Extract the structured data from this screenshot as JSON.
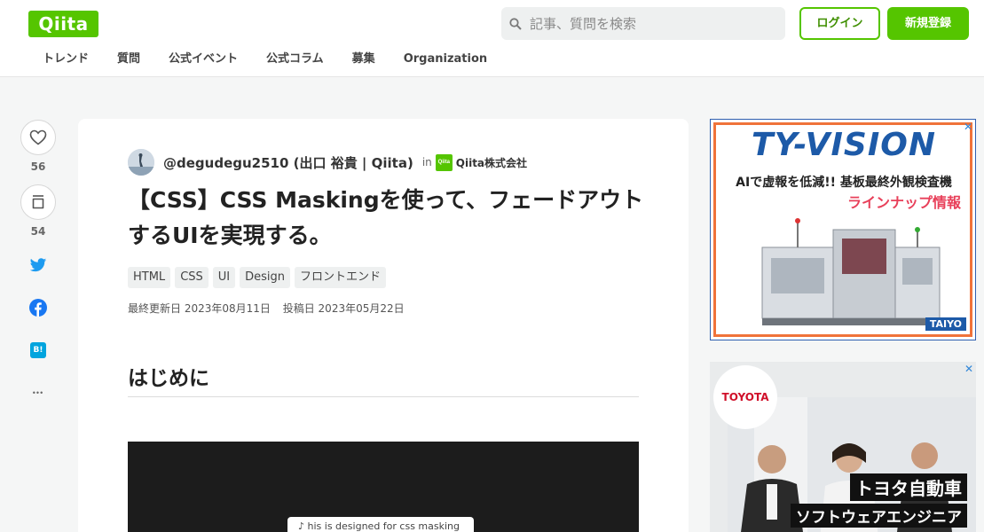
{
  "header": {
    "logo_text": "Qiita",
    "search_placeholder": "記事、質問を検索",
    "login_label": "ログイン",
    "signup_label": "新規登録",
    "nav": [
      "トレンド",
      "質問",
      "公式イベント",
      "公式コラム",
      "募集",
      "Organization"
    ]
  },
  "rail": {
    "like_count": "56",
    "stock_count": "54",
    "icons": [
      "heart-icon",
      "stock-icon",
      "twitter-icon",
      "facebook-icon",
      "hatena-bookmark-icon",
      "more-icon"
    ],
    "hatena_label": "B!",
    "more_label": "•••"
  },
  "article": {
    "author": "@degudegu2510 (出口 裕貴 | Qiita)",
    "in_text": "in",
    "org_badge": "Qiita",
    "org_name": "Qiita株式会社",
    "title": "【CSS】CSS Maskingを使って、フェードアウトするUIを実現する。",
    "tags": [
      "HTML",
      "CSS",
      "UI",
      "Design",
      "フロントエンド"
    ],
    "updated": "最終更新日 2023年08月11日",
    "posted": "投稿日 2023年05月22日",
    "heading": "はじめに",
    "image_caption": "♪  his is designed for css masking"
  },
  "ads": {
    "close_glyph": "✕",
    "ad1": {
      "brand": "TY-VISION",
      "line1": "AIで虚報を低減!! 基板最終外観検査機",
      "line2": "ラインナップ情報",
      "maker": "TAIYO"
    },
    "ad2": {
      "logo": "TOYOTA",
      "line1": "トヨタ自動車",
      "line2": "ソフトウェアエンジニア"
    }
  },
  "colors": {
    "brand_green": "#55c500",
    "background": "#f5f6f6",
    "twitter": "#1d9bf0",
    "facebook": "#1877f2",
    "hatena": "#00a4de"
  }
}
